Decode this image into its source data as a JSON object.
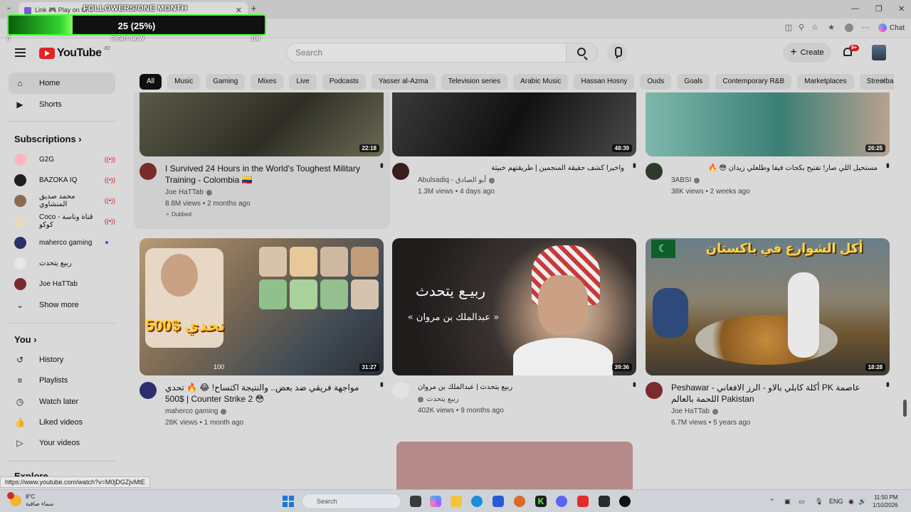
{
  "browser": {
    "tab_title": "Link 🎮 Play on Cr...",
    "address_url": "https://www.youtube.com/watch?v=M0jDGZjvMtE",
    "chat_label": "Chat"
  },
  "overlay": {
    "title": "FOLLOWERS/ONE MONTH",
    "value_label": "25 (25%)",
    "progress_fraction": 0.25,
    "min_label": "0",
    "now_label": "RIGHT NOW",
    "max_label": "100"
  },
  "header": {
    "logo_text": "YouTube",
    "country": "JO",
    "search_placeholder": "Search",
    "create_label": "Create",
    "notification_badge": "9+"
  },
  "sidebar": {
    "main": [
      {
        "label": "Home",
        "icon": "home-icon",
        "active": true
      },
      {
        "label": "Shorts",
        "icon": "shorts-icon"
      }
    ],
    "subscriptions_title": "Subscriptions",
    "subscriptions": [
      {
        "label": "G2G",
        "status": "live",
        "color": "#ffb3c0"
      },
      {
        "label": "BAZOKA IQ",
        "status": "live",
        "color": "#1e1e1e"
      },
      {
        "label": "محمد صديق المنشاوي",
        "status": "live",
        "color": "#8a6b52"
      },
      {
        "label": "Coco قناة وناسة - كوكو",
        "status": "live",
        "color": "#e8d9c0"
      },
      {
        "label": "maherco gaming",
        "status": "new",
        "color": "#2b2f6b"
      },
      {
        "label": "ربيع يتحدث",
        "status": "",
        "color": "#e6e6e6"
      },
      {
        "label": "Joe HaTTab",
        "status": "",
        "color": "#7a2b2b"
      }
    ],
    "show_more": "Show more",
    "you_title": "You",
    "you_items": [
      {
        "label": "History",
        "icon": "history-icon"
      },
      {
        "label": "Playlists",
        "icon": "playlists-icon"
      },
      {
        "label": "Watch later",
        "icon": "watch-later-icon"
      },
      {
        "label": "Liked videos",
        "icon": "liked-videos-icon"
      },
      {
        "label": "Your videos",
        "icon": "your-videos-icon"
      }
    ],
    "explore_title": "Explore"
  },
  "chips": [
    "All",
    "Music",
    "Gaming",
    "Mixes",
    "Live",
    "Podcasts",
    "Yasser al-Azma",
    "Television series",
    "Arabic Music",
    "Hassan Hosny",
    "Ouds",
    "Goals",
    "Contemporary R&B",
    "Marketplaces",
    "Streetball"
  ],
  "videos": [
    {
      "title": "I Survived 24 Hours in the World's Toughest Military Training - Colombia 🇨🇴",
      "channel": "Joe HaTTab",
      "views": "8.8M views",
      "age": "2 months ago",
      "duration": "22:18",
      "extra": "Dubbed",
      "rtl": false
    },
    {
      "title": "واخيرا كشف حقيقة المنجمين | طريقتهم خبيثة",
      "channel": "Abulsadiq - أبو الصادق",
      "views": "1.3M views",
      "age": "4 days ago",
      "duration": "48:39",
      "rtl": true
    },
    {
      "title": "مستحيل اللي صار! تفتيح بكجات فيفا وطلعلي زيدان 😳 🔥",
      "channel": "3ABSI",
      "views": "38K views",
      "age": "2 weeks ago",
      "duration": "26:25",
      "rtl": true
    },
    {
      "title": "مواجهة فريقي ضد بعض.. والنتيجة اكتساح! 😂 🔥 تحدي $500 | Counter Strike 2 😳",
      "channel": "maherco gaming",
      "views": "28K views",
      "age": "1 month ago",
      "duration": "31:27",
      "rtl": false
    },
    {
      "title": "ربيع يتحدث | عبدالملك بن مروان",
      "channel": "ربيع يتحدث",
      "views": "402K views",
      "age": "9 months ago",
      "duration": "39:36",
      "rtl": true
    },
    {
      "title": "Peshawar - أكلة كابلي بالاو - الرز الافغاني PK عاصمة اللحمة بالعالم Pakistan",
      "channel": "Joe HaTTab",
      "views": "6.7M views",
      "age": "5 years ago",
      "duration": "18:28",
      "rtl": false
    }
  ],
  "thumb_text": {
    "t2": "ربيـع يتحدث",
    "t2b": "« عبدالملك بن مروان »",
    "t3": "أكل الشوارع في باكستان",
    "t1": "تحدي $500",
    "t1b": "100"
  },
  "taskbar": {
    "temp": "8°C",
    "weather": "سماء صافية",
    "search": "Search",
    "lang": "ENG",
    "time": "11:50 PM",
    "date": "1/10/2026",
    "weather_badge": "3"
  }
}
